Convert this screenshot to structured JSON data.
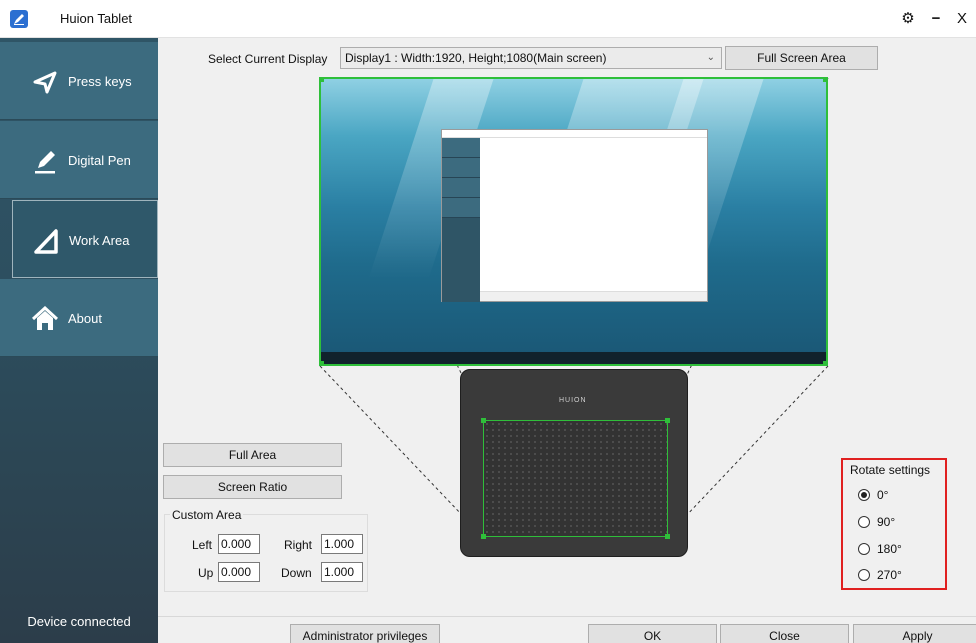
{
  "window": {
    "title": "Huion Tablet",
    "gear_glyph": "⚙",
    "minimize_glyph": "−",
    "close_glyph": "X"
  },
  "sidebar": {
    "items": [
      {
        "label": "Press keys",
        "icon": "send-arrow-icon"
      },
      {
        "label": "Digital Pen",
        "icon": "pen-icon"
      },
      {
        "label": "Work Area",
        "icon": "triangle-ruler-icon",
        "active": true
      },
      {
        "label": "About",
        "icon": "home-icon"
      }
    ],
    "status": "Device connected"
  },
  "display": {
    "label": "Select Current Display",
    "selected": "Display1 : Width:1920, Height;1080(Main screen)",
    "full_screen_button": "Full Screen Area"
  },
  "tablet": {
    "brand": "HUION"
  },
  "area_buttons": {
    "full_area": "Full Area",
    "screen_ratio": "Screen Ratio"
  },
  "custom_area": {
    "title": "Custom Area",
    "left_label": "Left",
    "left_value": "0.000",
    "right_label": "Right",
    "right_value": "1.000",
    "up_label": "Up",
    "up_value": "0.000",
    "down_label": "Down",
    "down_value": "1.000"
  },
  "rotate": {
    "title": "Rotate settings",
    "options": [
      "0°",
      "90°",
      "180°",
      "270°"
    ],
    "selected": "0°"
  },
  "footer": {
    "admin": "Administrator privileges",
    "ok": "OK",
    "close": "Close",
    "apply": "Apply"
  },
  "colors": {
    "sidebar": "#3c6b7f",
    "work_area_outline": "#2fbf3a",
    "rotate_highlight": "#e02020"
  }
}
